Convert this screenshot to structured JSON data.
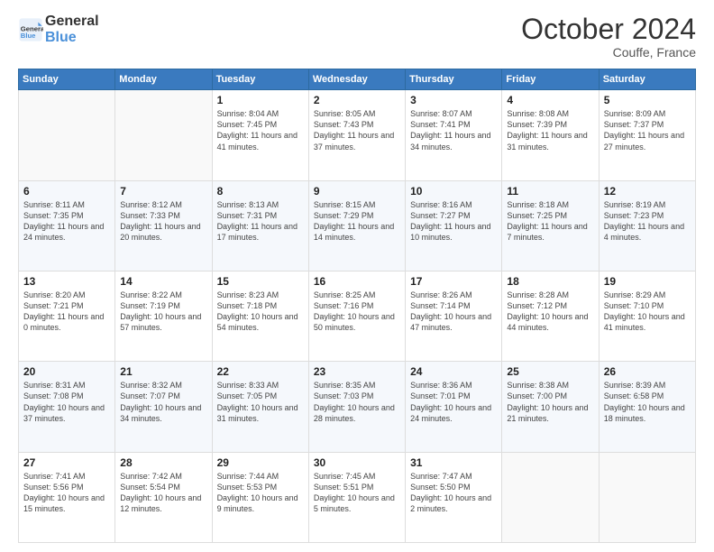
{
  "header": {
    "logo_line1": "General",
    "logo_line2": "Blue",
    "month": "October 2024",
    "location": "Couffe, France"
  },
  "days_of_week": [
    "Sunday",
    "Monday",
    "Tuesday",
    "Wednesday",
    "Thursday",
    "Friday",
    "Saturday"
  ],
  "weeks": [
    [
      {
        "day": "",
        "info": ""
      },
      {
        "day": "",
        "info": ""
      },
      {
        "day": "1",
        "info": "Sunrise: 8:04 AM\nSunset: 7:45 PM\nDaylight: 11 hours and 41 minutes."
      },
      {
        "day": "2",
        "info": "Sunrise: 8:05 AM\nSunset: 7:43 PM\nDaylight: 11 hours and 37 minutes."
      },
      {
        "day": "3",
        "info": "Sunrise: 8:07 AM\nSunset: 7:41 PM\nDaylight: 11 hours and 34 minutes."
      },
      {
        "day": "4",
        "info": "Sunrise: 8:08 AM\nSunset: 7:39 PM\nDaylight: 11 hours and 31 minutes."
      },
      {
        "day": "5",
        "info": "Sunrise: 8:09 AM\nSunset: 7:37 PM\nDaylight: 11 hours and 27 minutes."
      }
    ],
    [
      {
        "day": "6",
        "info": "Sunrise: 8:11 AM\nSunset: 7:35 PM\nDaylight: 11 hours and 24 minutes."
      },
      {
        "day": "7",
        "info": "Sunrise: 8:12 AM\nSunset: 7:33 PM\nDaylight: 11 hours and 20 minutes."
      },
      {
        "day": "8",
        "info": "Sunrise: 8:13 AM\nSunset: 7:31 PM\nDaylight: 11 hours and 17 minutes."
      },
      {
        "day": "9",
        "info": "Sunrise: 8:15 AM\nSunset: 7:29 PM\nDaylight: 11 hours and 14 minutes."
      },
      {
        "day": "10",
        "info": "Sunrise: 8:16 AM\nSunset: 7:27 PM\nDaylight: 11 hours and 10 minutes."
      },
      {
        "day": "11",
        "info": "Sunrise: 8:18 AM\nSunset: 7:25 PM\nDaylight: 11 hours and 7 minutes."
      },
      {
        "day": "12",
        "info": "Sunrise: 8:19 AM\nSunset: 7:23 PM\nDaylight: 11 hours and 4 minutes."
      }
    ],
    [
      {
        "day": "13",
        "info": "Sunrise: 8:20 AM\nSunset: 7:21 PM\nDaylight: 11 hours and 0 minutes."
      },
      {
        "day": "14",
        "info": "Sunrise: 8:22 AM\nSunset: 7:19 PM\nDaylight: 10 hours and 57 minutes."
      },
      {
        "day": "15",
        "info": "Sunrise: 8:23 AM\nSunset: 7:18 PM\nDaylight: 10 hours and 54 minutes."
      },
      {
        "day": "16",
        "info": "Sunrise: 8:25 AM\nSunset: 7:16 PM\nDaylight: 10 hours and 50 minutes."
      },
      {
        "day": "17",
        "info": "Sunrise: 8:26 AM\nSunset: 7:14 PM\nDaylight: 10 hours and 47 minutes."
      },
      {
        "day": "18",
        "info": "Sunrise: 8:28 AM\nSunset: 7:12 PM\nDaylight: 10 hours and 44 minutes."
      },
      {
        "day": "19",
        "info": "Sunrise: 8:29 AM\nSunset: 7:10 PM\nDaylight: 10 hours and 41 minutes."
      }
    ],
    [
      {
        "day": "20",
        "info": "Sunrise: 8:31 AM\nSunset: 7:08 PM\nDaylight: 10 hours and 37 minutes."
      },
      {
        "day": "21",
        "info": "Sunrise: 8:32 AM\nSunset: 7:07 PM\nDaylight: 10 hours and 34 minutes."
      },
      {
        "day": "22",
        "info": "Sunrise: 8:33 AM\nSunset: 7:05 PM\nDaylight: 10 hours and 31 minutes."
      },
      {
        "day": "23",
        "info": "Sunrise: 8:35 AM\nSunset: 7:03 PM\nDaylight: 10 hours and 28 minutes."
      },
      {
        "day": "24",
        "info": "Sunrise: 8:36 AM\nSunset: 7:01 PM\nDaylight: 10 hours and 24 minutes."
      },
      {
        "day": "25",
        "info": "Sunrise: 8:38 AM\nSunset: 7:00 PM\nDaylight: 10 hours and 21 minutes."
      },
      {
        "day": "26",
        "info": "Sunrise: 8:39 AM\nSunset: 6:58 PM\nDaylight: 10 hours and 18 minutes."
      }
    ],
    [
      {
        "day": "27",
        "info": "Sunrise: 7:41 AM\nSunset: 5:56 PM\nDaylight: 10 hours and 15 minutes."
      },
      {
        "day": "28",
        "info": "Sunrise: 7:42 AM\nSunset: 5:54 PM\nDaylight: 10 hours and 12 minutes."
      },
      {
        "day": "29",
        "info": "Sunrise: 7:44 AM\nSunset: 5:53 PM\nDaylight: 10 hours and 9 minutes."
      },
      {
        "day": "30",
        "info": "Sunrise: 7:45 AM\nSunset: 5:51 PM\nDaylight: 10 hours and 5 minutes."
      },
      {
        "day": "31",
        "info": "Sunrise: 7:47 AM\nSunset: 5:50 PM\nDaylight: 10 hours and 2 minutes."
      },
      {
        "day": "",
        "info": ""
      },
      {
        "day": "",
        "info": ""
      }
    ]
  ]
}
